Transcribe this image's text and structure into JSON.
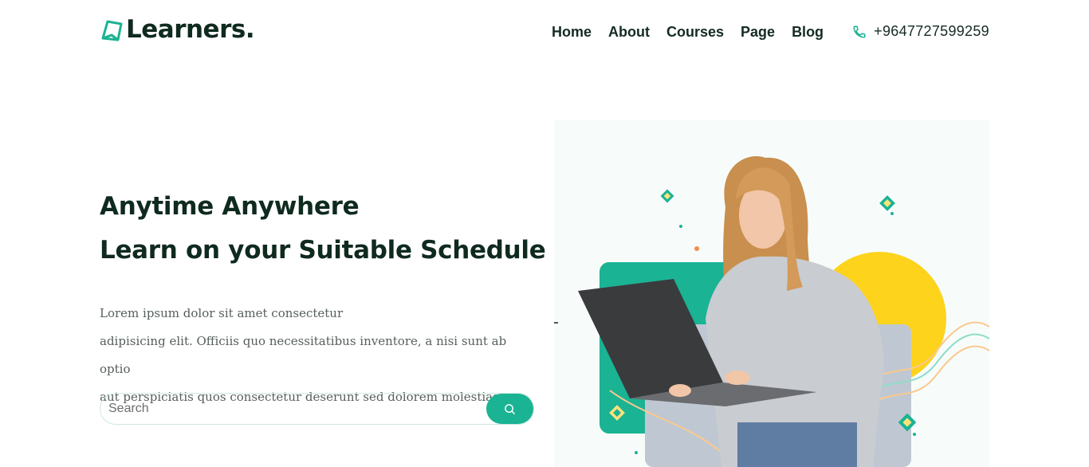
{
  "brand": {
    "name": "Learners.",
    "accent": "#1ab394",
    "dark": "#0f2a1f",
    "icon": "book-logo-icon"
  },
  "nav": {
    "items": [
      {
        "label": "Home"
      },
      {
        "label": "About"
      },
      {
        "label": "Courses"
      },
      {
        "label": "Page"
      },
      {
        "label": "Blog"
      }
    ]
  },
  "contact": {
    "phone": "+9647727599259",
    "icon": "phone-icon"
  },
  "hero": {
    "title_line1": "Anytime Anywhere",
    "title_line2": "Learn on your Suitable Schedule",
    "desc_line1": "Lorem ipsum dolor sit amet consectetur",
    "desc_line2": "adipisicing elit. Officiis quo necessitatibus inventore, a nisi sunt ab optio",
    "desc_line3": "aut perspiciatis quos consectetur deserunt sed dolorem molestias."
  },
  "search": {
    "placeholder": "Search",
    "value": "",
    "button_icon": "search-icon"
  },
  "illustration": {
    "colors": {
      "yellow": "#fdd31c",
      "teal": "#1ab394",
      "laptop": "#3a3b3d",
      "sweater": "#c9ccd1",
      "hair": "#c98f4e",
      "diamond_green": "#1ab394",
      "diamond_yellow": "#fde27a",
      "bg": "#f7fcfb"
    }
  }
}
